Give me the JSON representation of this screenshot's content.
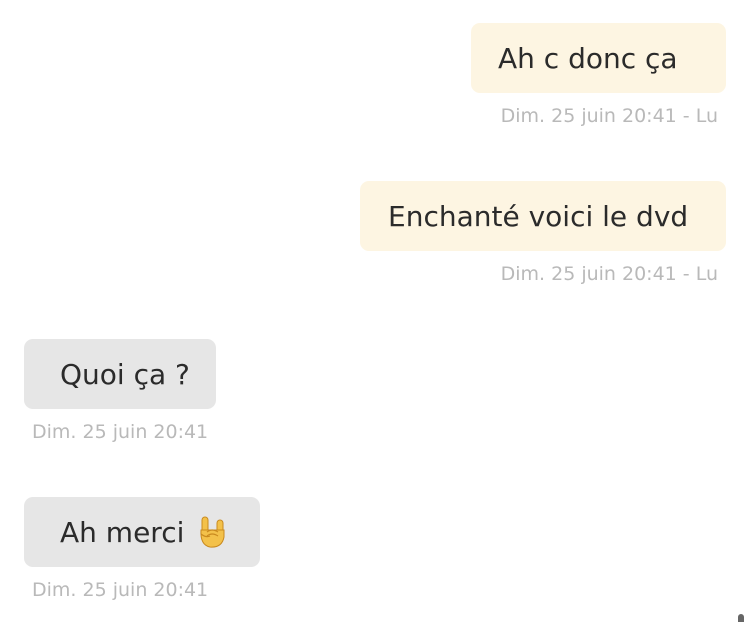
{
  "messages": [
    {
      "direction": "sent",
      "text": "Ah c donc ça",
      "meta": "Dim. 25 juin 20:41 - Lu"
    },
    {
      "direction": "sent",
      "text": "Enchanté voici le dvd",
      "meta": "Dim. 25 juin 20:41 - Lu"
    },
    {
      "direction": "received",
      "text": "Quoi ça ?",
      "meta": "Dim. 25 juin 20:41"
    },
    {
      "direction": "received",
      "text": "Ah merci",
      "emoji": "sign-of-the-horns-emoji",
      "meta": "Dim. 25 juin 20:41"
    }
  ],
  "colors": {
    "sent_bubble": "#fdf5e2",
    "received_bubble": "#e6e6e6",
    "text": "#2b2b2b",
    "meta_text": "#b9b9b9"
  }
}
